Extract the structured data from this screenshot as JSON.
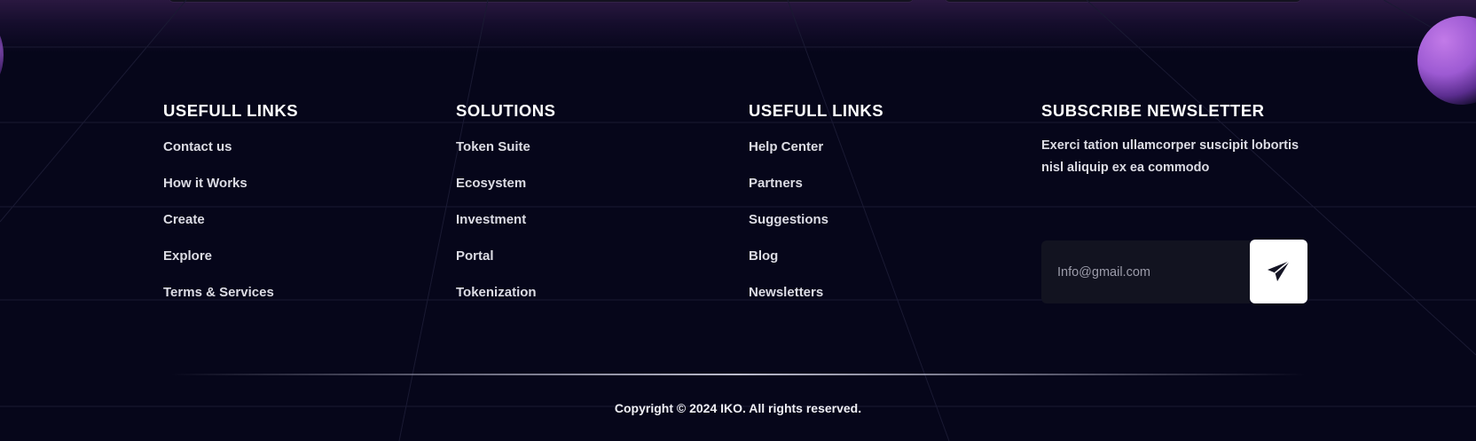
{
  "columns": [
    {
      "title": "USEFULL LINKS",
      "links": [
        "Contact us",
        "How it Works",
        "Create",
        "Explore",
        "Terms & Services"
      ]
    },
    {
      "title": "SOLUTIONS",
      "links": [
        "Token Suite",
        "Ecosystem",
        "Investment",
        "Portal",
        "Tokenization"
      ]
    },
    {
      "title": "USEFULL LINKS",
      "links": [
        "Help Center",
        "Partners",
        "Suggestions",
        "Blog",
        "Newsletters"
      ]
    }
  ],
  "newsletter": {
    "title": "SUBSCRIBE NEWSLETTER",
    "description": "Exerci tation ullamcorper suscipit lobortis nisl aliquip ex ea commodo",
    "email_placeholder": "Info@gmail.com",
    "send_icon": "paper-plane-icon"
  },
  "footer": {
    "copyright": "Copyright © 2024 IKO. All rights reserved."
  },
  "colors": {
    "background": "#06061a",
    "accent_purple": "#9d5ad3",
    "text": "#dcdce4",
    "button_bg": "#ffffff"
  }
}
